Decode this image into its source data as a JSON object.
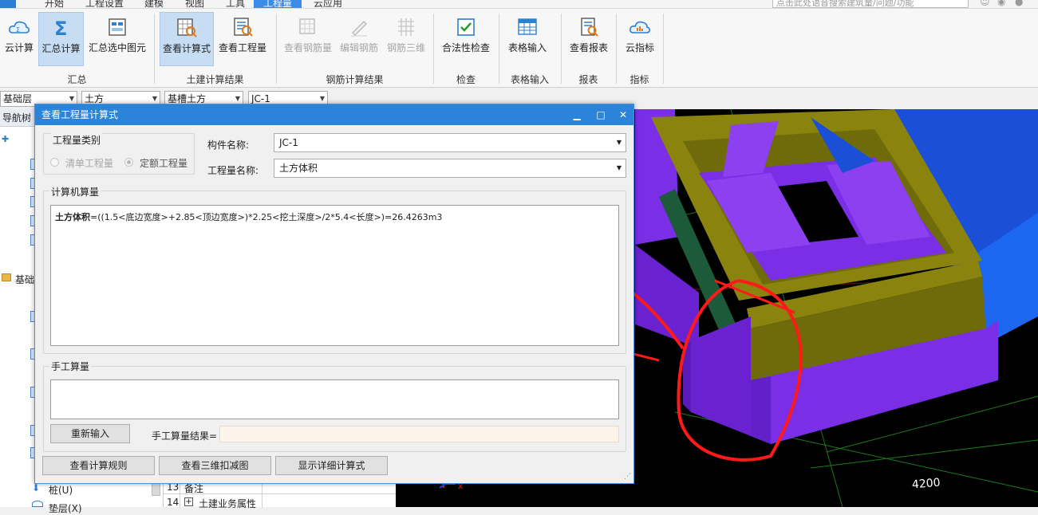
{
  "menu": [
    "开始",
    "工程设置",
    "建模",
    "视图",
    "工具",
    "工程量",
    "云应用"
  ],
  "search_placeholder": "点击此处语音搜索建筑量/问题/功能",
  "ribbon": {
    "buttons": [
      "云计算",
      "汇总计算",
      "汇总选中图元",
      "查看计算式",
      "查看工程量",
      "查看钢筋量",
      "编辑钢筋",
      "钢筋三维",
      "合法性检查",
      "表格输入",
      "查看报表",
      "云指标"
    ],
    "groups": [
      "汇总",
      "土建计算结果",
      "钢筋计算结果",
      "检查",
      "表格输入",
      "报表",
      "指标"
    ]
  },
  "combos": [
    "基础层",
    "土方",
    "基槽土方",
    "JC-1"
  ],
  "nav": {
    "header": "导航树",
    "item_foundation": "基础",
    "item_pile": "桩(U)",
    "item_cushion": "垫层(X)"
  },
  "props": {
    "row13_num": "13",
    "row13_label": "备注",
    "row14_num": "14",
    "row14_label": "土建业务属性"
  },
  "dialog": {
    "title": "查看工程量计算式",
    "type_group": "工程量类别",
    "radio_list": "清单工程量",
    "radio_quota": "定额工程量",
    "component_label": "构件名称:",
    "component_value": "JC-1",
    "quantity_label": "工程量名称:",
    "quantity_value": "土方体积",
    "computer_group": "计算机算量",
    "formula_name": "土方体积",
    "formula_body": "=((1.5<底边宽度>+2.85<顶边宽度>)*2.25<挖土深度>/2*5.4<长度>)=26.4263m3",
    "manual_group": "手工算量",
    "reenter_button": "重新输入",
    "manual_result_label": "手工算量结果=",
    "btn_rules": "查看计算规则",
    "btn_3d": "查看三维扣减图",
    "btn_detail": "显示详细计算式"
  },
  "view": {
    "dimension": "4200"
  },
  "colors": {
    "accent": "#2b83da",
    "purple": "#7a2ee6",
    "olive": "#6f6a0a",
    "annotation": "#ff1a1a"
  }
}
